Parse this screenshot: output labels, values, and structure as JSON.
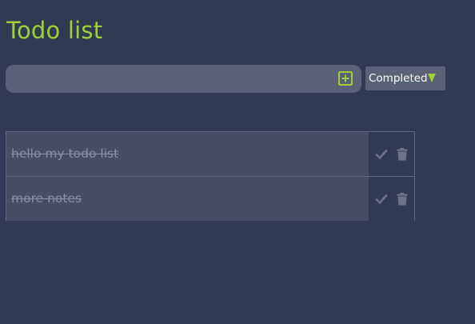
{
  "app": {
    "title": "Todo list"
  },
  "todo_form": {
    "input_value": "",
    "input_placeholder": "",
    "add_icon": "plus-square-icon"
  },
  "filter": {
    "selected": "Completed",
    "arrow_icon": "triangle-down-icon"
  },
  "todos": [
    {
      "text": "hello my todo list",
      "completed": true,
      "check_icon": "check-icon",
      "delete_icon": "trash-icon"
    },
    {
      "text": "more notes",
      "completed": true,
      "check_icon": "check-icon",
      "delete_icon": "trash-icon"
    }
  ],
  "colors": {
    "background": "#303a52",
    "accent": "#9fd13a",
    "input_bg": "#5b6176",
    "item_bg": "#474d62",
    "completed_text": "#8b91a3",
    "action_icon": "#6e7486"
  }
}
